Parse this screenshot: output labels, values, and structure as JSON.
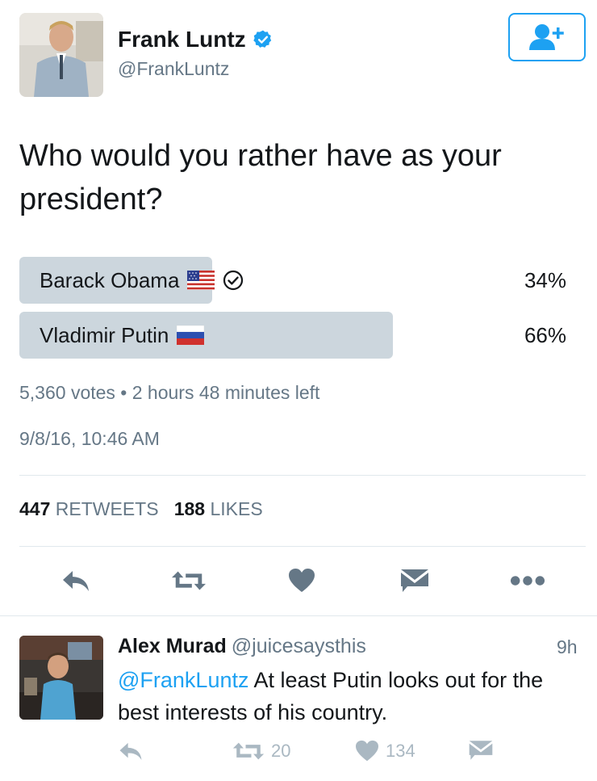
{
  "author": {
    "name": "Frank Luntz",
    "handle": "@FrankLuntz"
  },
  "tweet": {
    "question": "Who would you rather have as your president?",
    "poll": {
      "options": [
        {
          "label": "Barack Obama",
          "percent": "34%",
          "fraction": 0.34,
          "flag": "us-flag-icon",
          "winner_check": true
        },
        {
          "label": "Vladimir Putin",
          "percent": "66%",
          "fraction": 0.66,
          "flag": "russia-flag-icon",
          "winner_check": false
        }
      ],
      "meta": "5,360 votes • 2 hours 48 minutes left"
    },
    "timestamp": "9/8/16, 10:46 AM",
    "retweets_count": "447",
    "retweets_label": "RETWEETS",
    "likes_count": "188",
    "likes_label": "LIKES"
  },
  "reply": {
    "name": "Alex Murad",
    "handle": "@juicesaysthis",
    "time": "9h",
    "mention": "@FrankLuntz",
    "text": " At least Putin looks out for the best interests of his country.",
    "retweets": "20",
    "likes": "134"
  },
  "colors": {
    "accent": "#1da1f2",
    "muted": "#657786",
    "bar": "#ccd6dd",
    "icon": "#8899a6"
  }
}
